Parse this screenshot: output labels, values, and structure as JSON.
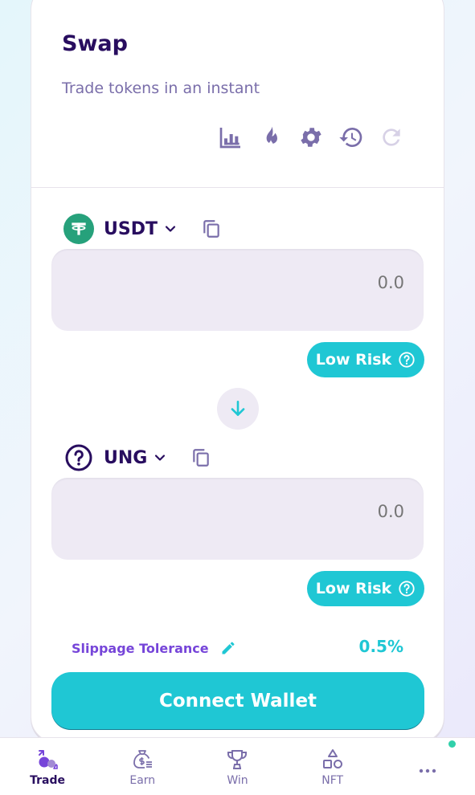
{
  "swap": {
    "title": "Swap",
    "subtitle": "Trade tokens in an instant"
  },
  "toolbar": {
    "icons": [
      "chart-icon",
      "fire-icon",
      "settings-gear-icon",
      "history-icon",
      "refresh-icon"
    ]
  },
  "from_token": {
    "symbol": "USDT",
    "amount_placeholder": "0.0",
    "risk_label": "Low Risk"
  },
  "to_token": {
    "symbol": "UNG",
    "amount_placeholder": "0.0",
    "risk_label": "Low Risk"
  },
  "slippage": {
    "label": "Slippage Tolerance",
    "value": "0.5%"
  },
  "connect_wallet": "Connect Wallet",
  "nav": {
    "items": [
      {
        "label": "Trade",
        "active": true
      },
      {
        "label": "Earn"
      },
      {
        "label": "Win"
      },
      {
        "label": "NFT"
      },
      {
        "label": ""
      }
    ]
  },
  "colors": {
    "primary": "#1fc7d4",
    "text": "#280d5f",
    "text_subtle": "#7a6eaa",
    "secondary": "#7645d9",
    "input_bg": "#eeeaf4",
    "success": "#31d0aa",
    "tether": "#26a17b"
  }
}
